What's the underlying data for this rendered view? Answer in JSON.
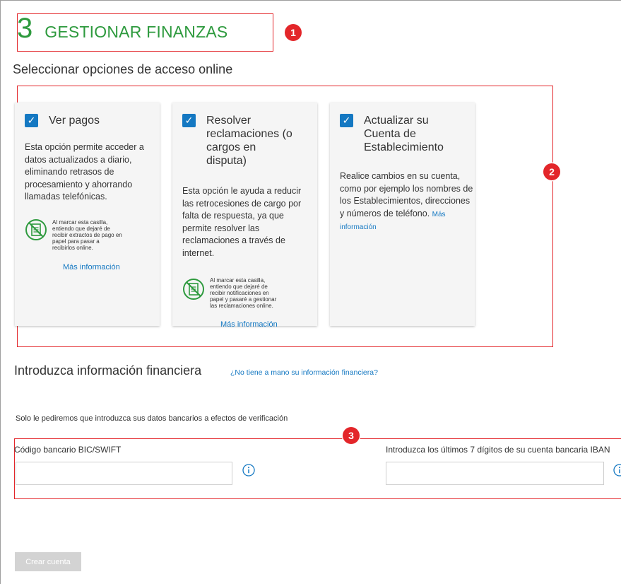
{
  "step": {
    "number": "3",
    "title": "GESTIONAR FINANZAS"
  },
  "online_access": {
    "heading": "Seleccionar opciones de acceso online",
    "cards": [
      {
        "title_lines": [
          "Ver pagos"
        ],
        "checked": true,
        "description": "Esta opción permite acceder a datos actualizados a diario, eliminando retrasos de procesamiento y ahorrando llamadas telefónicas.",
        "notice_lines": [
          "Al marcar esta casilla,",
          "entiendo que dejaré de",
          "recibir extractos de pago en",
          "papel para pasar a",
          "recibirlos online."
        ],
        "more_info": "Más información"
      },
      {
        "title_lines": [
          "Resolver",
          "reclamaciones (o",
          "cargos en",
          "disputa)"
        ],
        "checked": true,
        "description": "Esta opción le ayuda a reducir las retrocesiones de cargo por falta de respuesta, ya que permite resolver las reclamaciones a través de internet.",
        "notice_lines": [
          "Al marcar esta casilla,",
          "entiendo que dejaré de",
          "recibir notificaciones en",
          "papel y pasaré a gestionar",
          "las reclamaciones online."
        ],
        "more_info": "Más información"
      },
      {
        "title_lines": [
          "Actualizar su",
          "Cuenta de",
          "Establecimiento"
        ],
        "checked": true,
        "description": "Realice cambios en su cuenta, como por ejemplo los nombres de los Establecimientos, direcciones y números de teléfono.",
        "more_info": "Más información"
      }
    ]
  },
  "financial_info": {
    "heading": "Introduzca información financiera",
    "help_link": "¿No tiene a mano su información financiera?",
    "verification_text": "Solo le pediremos que introduzca sus datos bancarios a efectos de verificación",
    "bic_label": "Código bancario BIC/SWIFT",
    "bic_value": "",
    "iban_label": "Introduzca los últimos 7 dígitos de su cuenta bancaria IBAN",
    "iban_value": ""
  },
  "create_button": "Crear cuenta",
  "annotations": [
    "1",
    "2",
    "3"
  ],
  "colors": {
    "accent_green": "#2e9a3e",
    "link_blue": "#1478c2",
    "annotation_red": "#e3262a",
    "checkbox_blue": "#1478c2"
  }
}
